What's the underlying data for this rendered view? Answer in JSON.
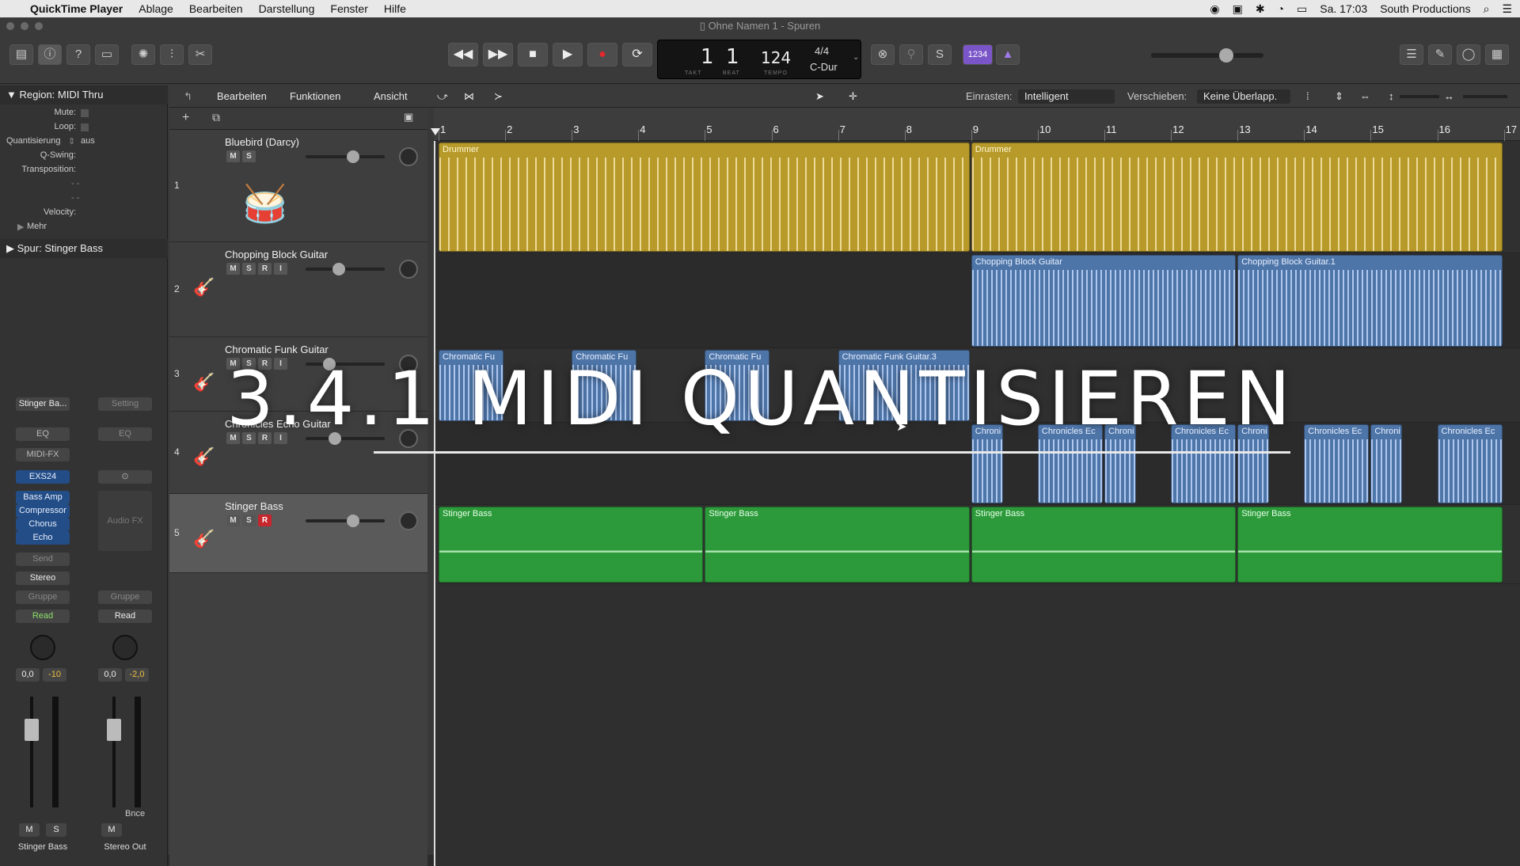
{
  "menubar": {
    "app_name": "QuickTime Player",
    "items": [
      "Ablage",
      "Bearbeiten",
      "Darstellung",
      "Fenster",
      "Hilfe"
    ],
    "clock": "Sa. 17:03",
    "user": "South Productions"
  },
  "window": {
    "title": "Ohne Namen 1 - Spuren"
  },
  "lcd": {
    "bar": "1",
    "beat": "1",
    "bar_label": "TAKT",
    "beat_label": "BEAT",
    "tempo": "124",
    "tempo_label": "TEMPO",
    "signature": "4/4",
    "key": "C-Dur"
  },
  "count_in": "1234",
  "local_menus": {
    "edit": "Bearbeiten",
    "functions": "Funktionen",
    "view": "Ansicht"
  },
  "snap": {
    "label": "Einrasten:",
    "value": "Intelligent"
  },
  "drag": {
    "label": "Verschieben:",
    "value": "Keine Überlapp."
  },
  "inspector": {
    "region_label": "Region:",
    "region_name": "MIDI Thru",
    "rows": {
      "mute": "Mute:",
      "loop": "Loop:",
      "quantize": "Quantisierung",
      "quantize_value": "aus",
      "qswing": "Q-Swing:",
      "transposition": "Transposition:",
      "dash1": "- -",
      "dash2": "- -",
      "velocity": "Velocity:",
      "more": "Mehr"
    },
    "track_label": "Spur:",
    "track_name": "Stinger Bass"
  },
  "channel_strip_1": {
    "setting": "Stinger Ba...",
    "eq": "EQ",
    "midi_fx": "MIDI-FX",
    "instrument": "EXS24",
    "plugins": [
      "Bass Amp",
      "Compressor",
      "Chorus",
      "Echo"
    ],
    "send": "Send",
    "output": "Stereo",
    "group": "Gruppe",
    "automation": "Read",
    "volume": "0,0",
    "peak": "-10",
    "mute": "M",
    "solo": "S",
    "name": "Stinger Bass"
  },
  "channel_strip_2": {
    "setting": "Setting",
    "eq": "EQ",
    "audio_fx": "Audio FX",
    "group": "Gruppe",
    "automation": "Read",
    "volume": "0,0",
    "peak": "-2,0",
    "bounce": "Bnce",
    "mute": "M",
    "name": "Stereo Out"
  },
  "track_buttons": {
    "mute": "M",
    "solo": "S",
    "record": "R",
    "input": "I"
  },
  "tracks": [
    {
      "number": "1",
      "name": "Bluebird (Darcy)",
      "volume": 0.62
    },
    {
      "number": "2",
      "name": "Chopping Block Guitar",
      "volume": 0.4
    },
    {
      "number": "3",
      "name": "Chromatic Funk Guitar",
      "volume": 0.26
    },
    {
      "number": "4",
      "name": "Chronicles Echo Guitar",
      "volume": 0.34
    },
    {
      "number": "5",
      "name": "Stinger Bass",
      "volume": 0.62
    }
  ],
  "ruler": {
    "bars": [
      "1",
      "2",
      "3",
      "4",
      "5",
      "6",
      "7",
      "8",
      "9",
      "10",
      "11",
      "12",
      "13",
      "14",
      "15",
      "16",
      "17"
    ]
  },
  "regions": {
    "drummer": [
      "Drummer",
      "Drummer"
    ],
    "chopping": [
      "Chopping Block Guitar",
      "Chopping Block Guitar.1"
    ],
    "chromatic": [
      "Chromatic Fu",
      "Chromatic Fu",
      "Chromatic Fu",
      "Chromatic Funk Guitar.3"
    ],
    "chronicles": [
      "Chroni",
      "Chronicles Ec",
      "Chroni",
      "Chronicles Ec",
      "Chroni",
      "Chronicles Ec",
      "Chroni",
      "Chronicles Ec"
    ],
    "bass": [
      "Stinger Bass",
      "Stinger Bass",
      "Stinger Bass",
      "Stinger Bass"
    ]
  },
  "overlay_title": "3.4.1 MIDI QUANTISIEREN",
  "colors": {
    "drummer": "#b79a2a",
    "audio": "#4e75a8",
    "midi": "#2c9a3a",
    "record": "#c6262c",
    "count_in": "#7a55c8"
  }
}
